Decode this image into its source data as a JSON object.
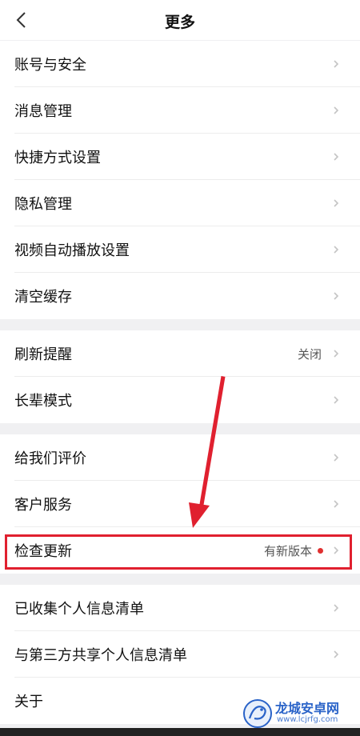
{
  "header": {
    "title": "更多"
  },
  "groups": [
    {
      "items": [
        {
          "label": "账号与安全"
        },
        {
          "label": "消息管理"
        },
        {
          "label": "快捷方式设置"
        },
        {
          "label": "隐私管理"
        },
        {
          "label": "视频自动播放设置"
        },
        {
          "label": "清空缓存"
        }
      ]
    },
    {
      "items": [
        {
          "label": "刷新提醒",
          "value": "关闭"
        },
        {
          "label": "长辈模式"
        }
      ]
    },
    {
      "items": [
        {
          "label": "给我们评价"
        },
        {
          "label": "客户服务"
        },
        {
          "label": "检查更新",
          "value": "有新版本"
        }
      ]
    },
    {
      "items": [
        {
          "label": "已收集个人信息清单"
        },
        {
          "label": "与第三方共享个人信息清单"
        },
        {
          "label": "关于"
        }
      ]
    }
  ],
  "watermark": {
    "name": "龙城安卓网",
    "url": "www.lcjrfg.com"
  },
  "colors": {
    "highlight": "#e0202f",
    "badge_dot": "#e03030"
  }
}
